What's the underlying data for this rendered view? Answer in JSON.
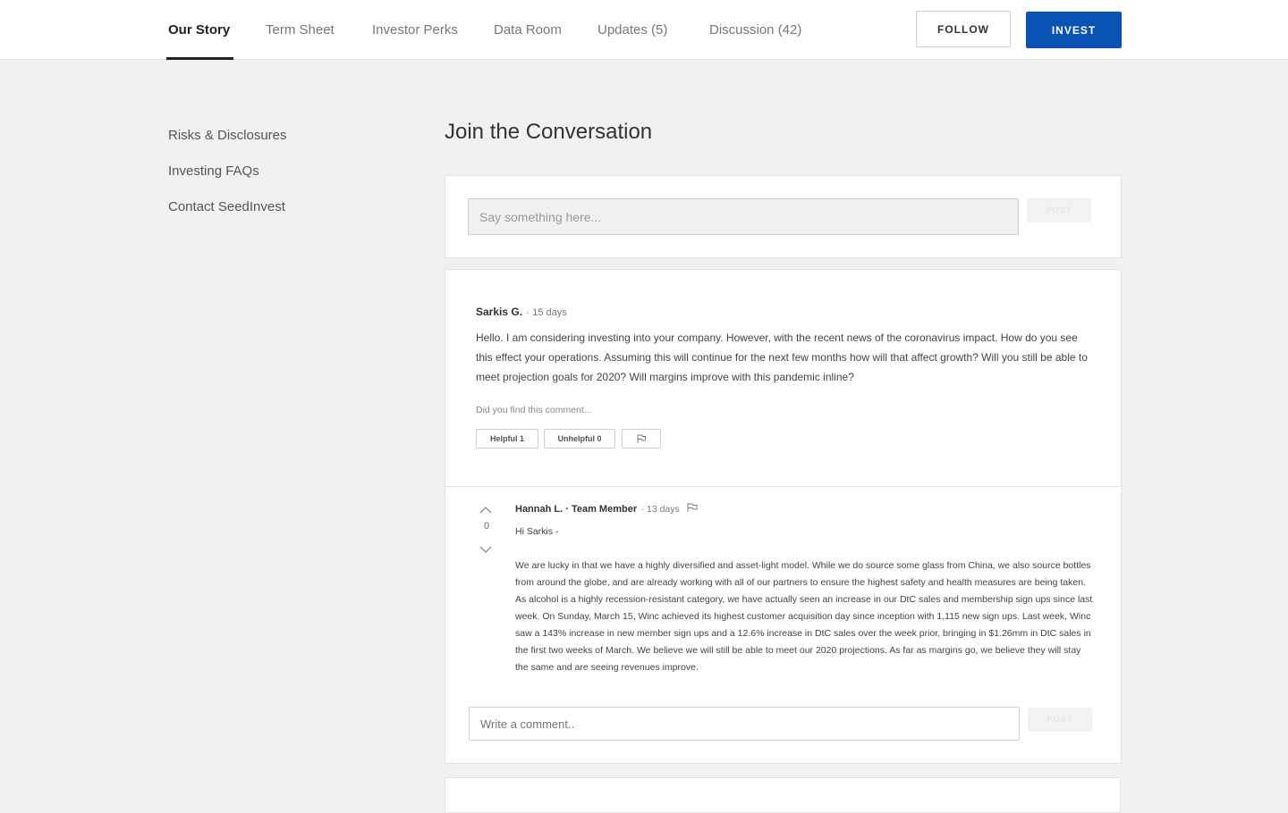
{
  "nav": {
    "tabs": [
      {
        "label": "Our Story",
        "active": true
      },
      {
        "label": "Term Sheet"
      },
      {
        "label": "Investor Perks"
      },
      {
        "label": "Data Room"
      },
      {
        "label": "Updates (5)"
      },
      {
        "label": "Discussion (42)"
      }
    ],
    "follow_label": "FOLLOW",
    "invest_label": "INVEST"
  },
  "sidebar": {
    "items": [
      {
        "label": "Risks & Disclosures"
      },
      {
        "label": "Investing FAQs"
      },
      {
        "label": "Contact SeedInvest"
      }
    ]
  },
  "main": {
    "heading": "Join the Conversation",
    "compose": {
      "placeholder": "Say something here...",
      "post_label": "POST"
    },
    "comment": {
      "author": "Sarkis G.",
      "time": "· 15 days",
      "text": "Hello. I am considering investing into your company. However, with the recent news of the coronavirus impact. How do you see this effect your operations. Assuming this will continue for the next few months how will that affect growth? Will you still be able to meet projection goals for 2020? Will margins improve with this pandemic inline?",
      "feedback_prompt": "Did you find this comment...",
      "helpful_label": "Helpful 1",
      "unhelpful_label": "Unhelpful 0"
    },
    "reply": {
      "author": "Hannah L. · Team Member",
      "time": "· 13 days",
      "votes": "0",
      "greeting": "Hi Sarkis -",
      "text": "We are lucky in that we have a highly diversified and asset-light model. While we do source some glass from China, we also source bottles from around the globe, and are already working with all of our partners to ensure the highest safety and health measures are being taken. As alcohol is a highly recession-resistant category, we have actually seen an increase in our DtC sales and membership sign ups since last week. On Sunday, March 15, Winc achieved its highest customer acquisition day since inception with 1,115 new sign ups. Last week, Winc saw a 143% increase in new member sign ups and a 12.6% increase in DtC sales over the week prior, bringing in $1.26mm in DtC sales in the first two weeks of March. We believe we will still be able to meet our 2020 projections. As far as margins go, we believe they will stay the same and are seeing revenues improve."
    },
    "reply_compose": {
      "placeholder": "Write a comment..",
      "post_label": "POST"
    }
  }
}
